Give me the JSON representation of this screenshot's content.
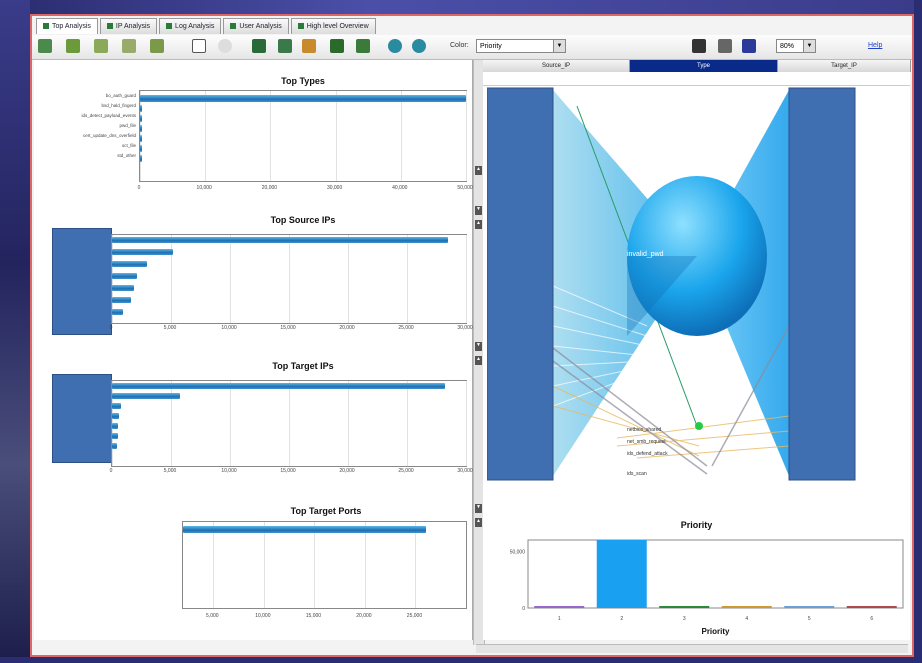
{
  "tabs": [
    {
      "label": "Top Analysis",
      "active": true
    },
    {
      "label": "IP Analysis",
      "active": false
    },
    {
      "label": "Log Analysis",
      "active": false
    },
    {
      "label": "User Analysis",
      "active": false
    },
    {
      "label": "High level Overview",
      "active": false
    }
  ],
  "toolbar": {
    "color_label": "Color:",
    "color_value": "Priority",
    "zoom_value": "80%",
    "help_label": "Help"
  },
  "columns": {
    "left": "Source_IP",
    "middle": "Type",
    "right": "Target_IP"
  },
  "viz_labels": {
    "center": "invalid_pwd",
    "items": [
      "netbios_shared",
      "net_smb_request",
      "ids_defend_attack",
      "ids_scan"
    ]
  },
  "charts": [
    {
      "id": "top-types",
      "title": "Top Types",
      "type": "bar",
      "categories": [
        "bo_auth_guard",
        "bsd_hald_fingerd",
        "ids_detect_payload_events",
        "pwd_file",
        "cert_update_dns_overfield",
        "oct_file",
        "std_other"
      ],
      "values": [
        50000,
        150,
        120,
        110,
        100,
        90,
        80
      ],
      "ticks": [
        "0",
        "10,000",
        "20,000",
        "30,000",
        "40,000",
        "50,000"
      ],
      "xmax": 50000
    },
    {
      "id": "top-source-ips",
      "title": "Top Source IPs",
      "type": "bar",
      "values": [
        28500,
        5200,
        3000,
        2100,
        1900,
        1600,
        900
      ],
      "ticks": [
        "0",
        "5,000",
        "10,000",
        "15,000",
        "20,000",
        "25,000",
        "30,000"
      ],
      "xmax": 30000
    },
    {
      "id": "top-target-ips",
      "title": "Top Target IPs",
      "type": "bar",
      "values": [
        28200,
        5800,
        800,
        600,
        500,
        500,
        450
      ],
      "ticks": [
        "0",
        "5,000",
        "10,000",
        "15,000",
        "20,000",
        "25,000",
        "30,000"
      ],
      "xmax": 30000
    },
    {
      "id": "top-target-ports",
      "title": "Top Target Ports",
      "type": "bar",
      "values": [
        26000
      ],
      "ticks": [
        "5,000",
        "10,000",
        "15,000",
        "20,000",
        "25,000"
      ],
      "xmin": 2000,
      "xmax": 30000
    },
    {
      "id": "priority",
      "title": "Priority",
      "type": "bar",
      "xlabel": "Priority",
      "categories": [
        "1",
        "2",
        "3",
        "4",
        "5",
        "6"
      ],
      "values": [
        1000,
        60000,
        800,
        700,
        600,
        500
      ],
      "colors": [
        "#9966cc",
        "#1aa0f0",
        "#2a8a3a",
        "#cc9933",
        "#6b9fd6",
        "#b04a4a"
      ],
      "ticks_y": [
        "0",
        "50,000"
      ],
      "ymax": 60000
    }
  ]
}
